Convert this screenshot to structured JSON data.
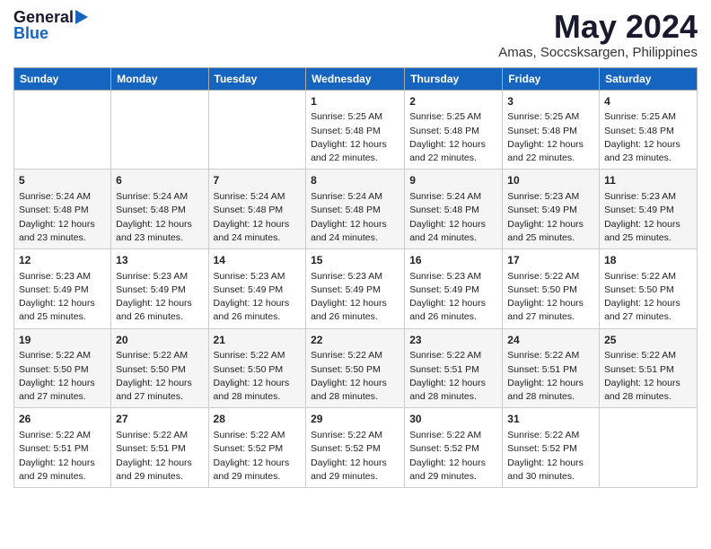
{
  "header": {
    "logo_general": "General",
    "logo_blue": "Blue",
    "month": "May 2024",
    "location": "Amas, Soccsksargen, Philippines"
  },
  "days_of_week": [
    "Sunday",
    "Monday",
    "Tuesday",
    "Wednesday",
    "Thursday",
    "Friday",
    "Saturday"
  ],
  "weeks": [
    {
      "cells": [
        {
          "day": "",
          "info": ""
        },
        {
          "day": "",
          "info": ""
        },
        {
          "day": "",
          "info": ""
        },
        {
          "day": "1",
          "info": "Sunrise: 5:25 AM\nSunset: 5:48 PM\nDaylight: 12 hours\nand 22 minutes."
        },
        {
          "day": "2",
          "info": "Sunrise: 5:25 AM\nSunset: 5:48 PM\nDaylight: 12 hours\nand 22 minutes."
        },
        {
          "day": "3",
          "info": "Sunrise: 5:25 AM\nSunset: 5:48 PM\nDaylight: 12 hours\nand 22 minutes."
        },
        {
          "day": "4",
          "info": "Sunrise: 5:25 AM\nSunset: 5:48 PM\nDaylight: 12 hours\nand 23 minutes."
        }
      ],
      "shaded": false
    },
    {
      "cells": [
        {
          "day": "5",
          "info": "Sunrise: 5:24 AM\nSunset: 5:48 PM\nDaylight: 12 hours\nand 23 minutes."
        },
        {
          "day": "6",
          "info": "Sunrise: 5:24 AM\nSunset: 5:48 PM\nDaylight: 12 hours\nand 23 minutes."
        },
        {
          "day": "7",
          "info": "Sunrise: 5:24 AM\nSunset: 5:48 PM\nDaylight: 12 hours\nand 24 minutes."
        },
        {
          "day": "8",
          "info": "Sunrise: 5:24 AM\nSunset: 5:48 PM\nDaylight: 12 hours\nand 24 minutes."
        },
        {
          "day": "9",
          "info": "Sunrise: 5:24 AM\nSunset: 5:48 PM\nDaylight: 12 hours\nand 24 minutes."
        },
        {
          "day": "10",
          "info": "Sunrise: 5:23 AM\nSunset: 5:49 PM\nDaylight: 12 hours\nand 25 minutes."
        },
        {
          "day": "11",
          "info": "Sunrise: 5:23 AM\nSunset: 5:49 PM\nDaylight: 12 hours\nand 25 minutes."
        }
      ],
      "shaded": true
    },
    {
      "cells": [
        {
          "day": "12",
          "info": "Sunrise: 5:23 AM\nSunset: 5:49 PM\nDaylight: 12 hours\nand 25 minutes."
        },
        {
          "day": "13",
          "info": "Sunrise: 5:23 AM\nSunset: 5:49 PM\nDaylight: 12 hours\nand 26 minutes."
        },
        {
          "day": "14",
          "info": "Sunrise: 5:23 AM\nSunset: 5:49 PM\nDaylight: 12 hours\nand 26 minutes."
        },
        {
          "day": "15",
          "info": "Sunrise: 5:23 AM\nSunset: 5:49 PM\nDaylight: 12 hours\nand 26 minutes."
        },
        {
          "day": "16",
          "info": "Sunrise: 5:23 AM\nSunset: 5:49 PM\nDaylight: 12 hours\nand 26 minutes."
        },
        {
          "day": "17",
          "info": "Sunrise: 5:22 AM\nSunset: 5:50 PM\nDaylight: 12 hours\nand 27 minutes."
        },
        {
          "day": "18",
          "info": "Sunrise: 5:22 AM\nSunset: 5:50 PM\nDaylight: 12 hours\nand 27 minutes."
        }
      ],
      "shaded": false
    },
    {
      "cells": [
        {
          "day": "19",
          "info": "Sunrise: 5:22 AM\nSunset: 5:50 PM\nDaylight: 12 hours\nand 27 minutes."
        },
        {
          "day": "20",
          "info": "Sunrise: 5:22 AM\nSunset: 5:50 PM\nDaylight: 12 hours\nand 27 minutes."
        },
        {
          "day": "21",
          "info": "Sunrise: 5:22 AM\nSunset: 5:50 PM\nDaylight: 12 hours\nand 28 minutes."
        },
        {
          "day": "22",
          "info": "Sunrise: 5:22 AM\nSunset: 5:50 PM\nDaylight: 12 hours\nand 28 minutes."
        },
        {
          "day": "23",
          "info": "Sunrise: 5:22 AM\nSunset: 5:51 PM\nDaylight: 12 hours\nand 28 minutes."
        },
        {
          "day": "24",
          "info": "Sunrise: 5:22 AM\nSunset: 5:51 PM\nDaylight: 12 hours\nand 28 minutes."
        },
        {
          "day": "25",
          "info": "Sunrise: 5:22 AM\nSunset: 5:51 PM\nDaylight: 12 hours\nand 28 minutes."
        }
      ],
      "shaded": true
    },
    {
      "cells": [
        {
          "day": "26",
          "info": "Sunrise: 5:22 AM\nSunset: 5:51 PM\nDaylight: 12 hours\nand 29 minutes."
        },
        {
          "day": "27",
          "info": "Sunrise: 5:22 AM\nSunset: 5:51 PM\nDaylight: 12 hours\nand 29 minutes."
        },
        {
          "day": "28",
          "info": "Sunrise: 5:22 AM\nSunset: 5:52 PM\nDaylight: 12 hours\nand 29 minutes."
        },
        {
          "day": "29",
          "info": "Sunrise: 5:22 AM\nSunset: 5:52 PM\nDaylight: 12 hours\nand 29 minutes."
        },
        {
          "day": "30",
          "info": "Sunrise: 5:22 AM\nSunset: 5:52 PM\nDaylight: 12 hours\nand 29 minutes."
        },
        {
          "day": "31",
          "info": "Sunrise: 5:22 AM\nSunset: 5:52 PM\nDaylight: 12 hours\nand 30 minutes."
        },
        {
          "day": "",
          "info": ""
        }
      ],
      "shaded": false
    }
  ]
}
